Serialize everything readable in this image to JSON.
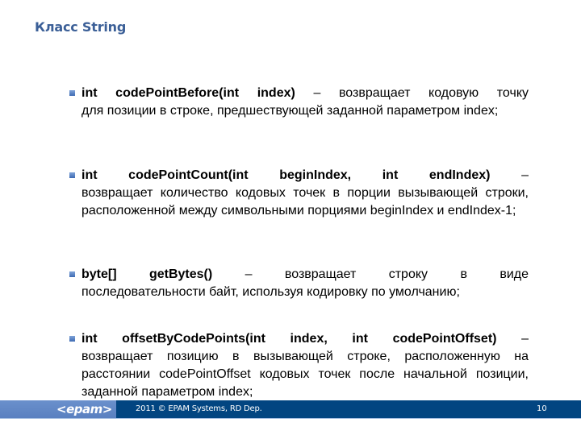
{
  "slide": {
    "title": "Класс String",
    "items": [
      {
        "signature": "int codePointBefore(int index)",
        "line1_rest": " – возвращает кодовую точку",
        "rest": "для позиции в строке, предшествующей заданной параметром index;"
      },
      {
        "signature": "int codePointCount(int beginIndex, int endIndex)",
        "line1_rest": " –",
        "rest": "возвращает количество кодовых точек в порции вызывающей строки, расположенной между символьными порциями beginIndex и endIndex-1;"
      },
      {
        "signature": "byte[] getBytes()",
        "line1_rest": " – возвращает строку в виде",
        "rest": "последовательности байт, используя кодировку по умолчанию;"
      },
      {
        "signature": "int offsetByCodePoints(int index, int codePointOffset)",
        "line1_rest": " –",
        "rest": "возвращает позицию в вызывающей строке, расположенную на расстоянии codePointOffset кодовых точек после начальной позиции, заданной параметром index;"
      }
    ]
  },
  "footer": {
    "logo": "<epam>",
    "copyright": "2011 © EPAM Systems, RD Dep.",
    "page_number": "10"
  },
  "colors": {
    "title": "#3b5f97",
    "footer_dark": "#024581",
    "footer_light": "#5a80c0",
    "bullet": "#3e6bb3"
  }
}
